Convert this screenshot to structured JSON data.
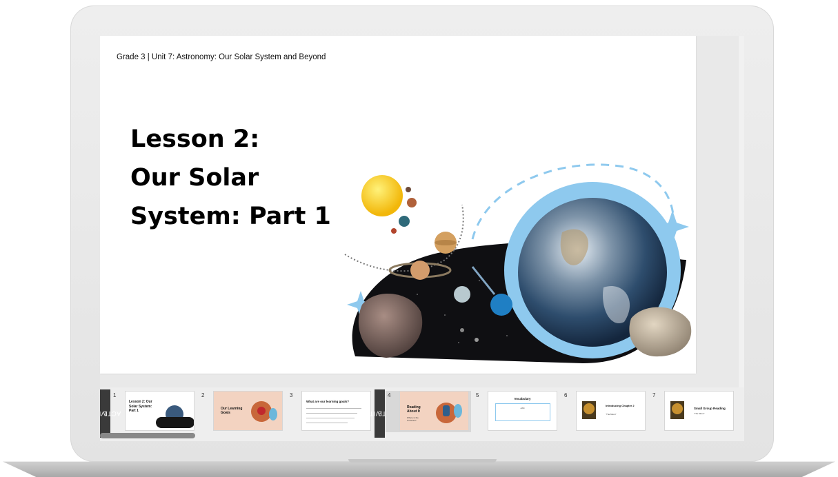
{
  "slide": {
    "breadcrumb": "Grade 3 | Unit 7: Astronomy: Our Solar System and Beyond",
    "title_lines": [
      "Lesson 2:",
      "Our Solar",
      "System: Part 1"
    ]
  },
  "filmstrip": {
    "activities": [
      {
        "label": "ACTIVITY",
        "number": "1"
      },
      {
        "label": "ACTIVITY",
        "number": "2"
      }
    ],
    "thumbnails": [
      {
        "number": "1",
        "title": "Lesson 2: Our Solar System: Part 1"
      },
      {
        "number": "2",
        "title": "Our Learning Goals"
      },
      {
        "number": "3",
        "title": "What are our learning goals?"
      },
      {
        "number": "4",
        "title": "Reading About It",
        "subtitle": "Where is the Universe?"
      },
      {
        "number": "5",
        "title": "Vocabulary",
        "subtitle": "orbit"
      },
      {
        "number": "6",
        "title": "Introducing Chapter 2",
        "subtitle": "“The Moon”"
      },
      {
        "number": "7",
        "title": "Small Group Reading",
        "subtitle": "“The Moon”"
      }
    ]
  },
  "colors": {
    "accent_peach": "#f3d3c1",
    "sky_blue": "#8ec9ee",
    "activity_tab": "#3a3a3a"
  }
}
